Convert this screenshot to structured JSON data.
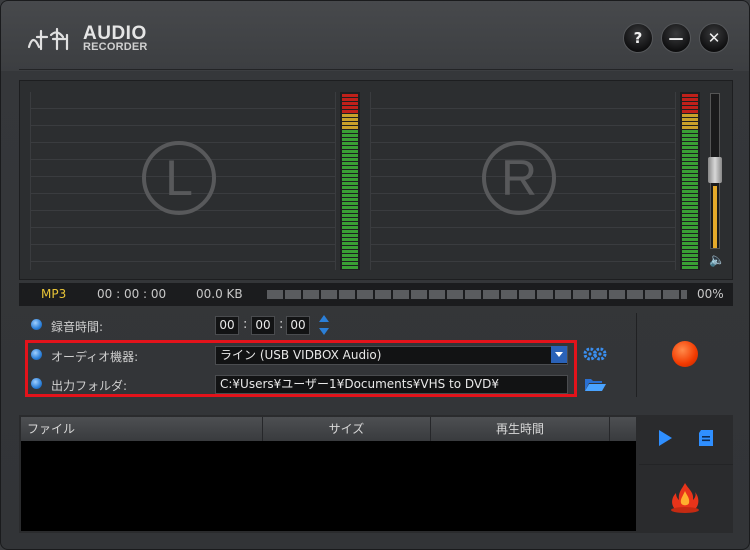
{
  "app": {
    "logo_word1": "AUDIO",
    "logo_word2": "RECORDER",
    "logo_icon": "htt-logo-icon"
  },
  "window_buttons": {
    "help": "?",
    "minimize": "—",
    "close": "✕"
  },
  "meters": {
    "left_label": "L",
    "right_label": "R",
    "vu_colors": {
      "low": "#3aa035",
      "mid": "#c8a02a",
      "high": "#c0201a"
    },
    "volume_level": 0.42
  },
  "status": {
    "format": "MP3",
    "time": "00 : 00 : 00",
    "size": "00.0 KB",
    "progress": 0,
    "percent": "00%"
  },
  "settings": {
    "rec_time_label": "録音時間:",
    "hours": "00",
    "minutes": "00",
    "seconds": "00",
    "colon": ":",
    "device_label": "オーディオ機器:",
    "device_value": "ライン (USB VIDBOX Audio)",
    "folder_label": "出力フォルダ:",
    "folder_value": "C:¥Users¥ユーザー1¥Documents¥VHS to DVD¥",
    "highlight_color": "#e3131b",
    "accent_color": "#2b7fd8"
  },
  "filelist": {
    "col_file": "ファイル",
    "col_size": "サイズ",
    "col_time": "再生時間"
  },
  "icons": {
    "settings": "gear-icon",
    "folder": "folder-open-icon",
    "record": "record-icon",
    "play": "play-icon",
    "document": "document-icon",
    "burn": "flame-icon",
    "speaker": "speaker-icon"
  }
}
